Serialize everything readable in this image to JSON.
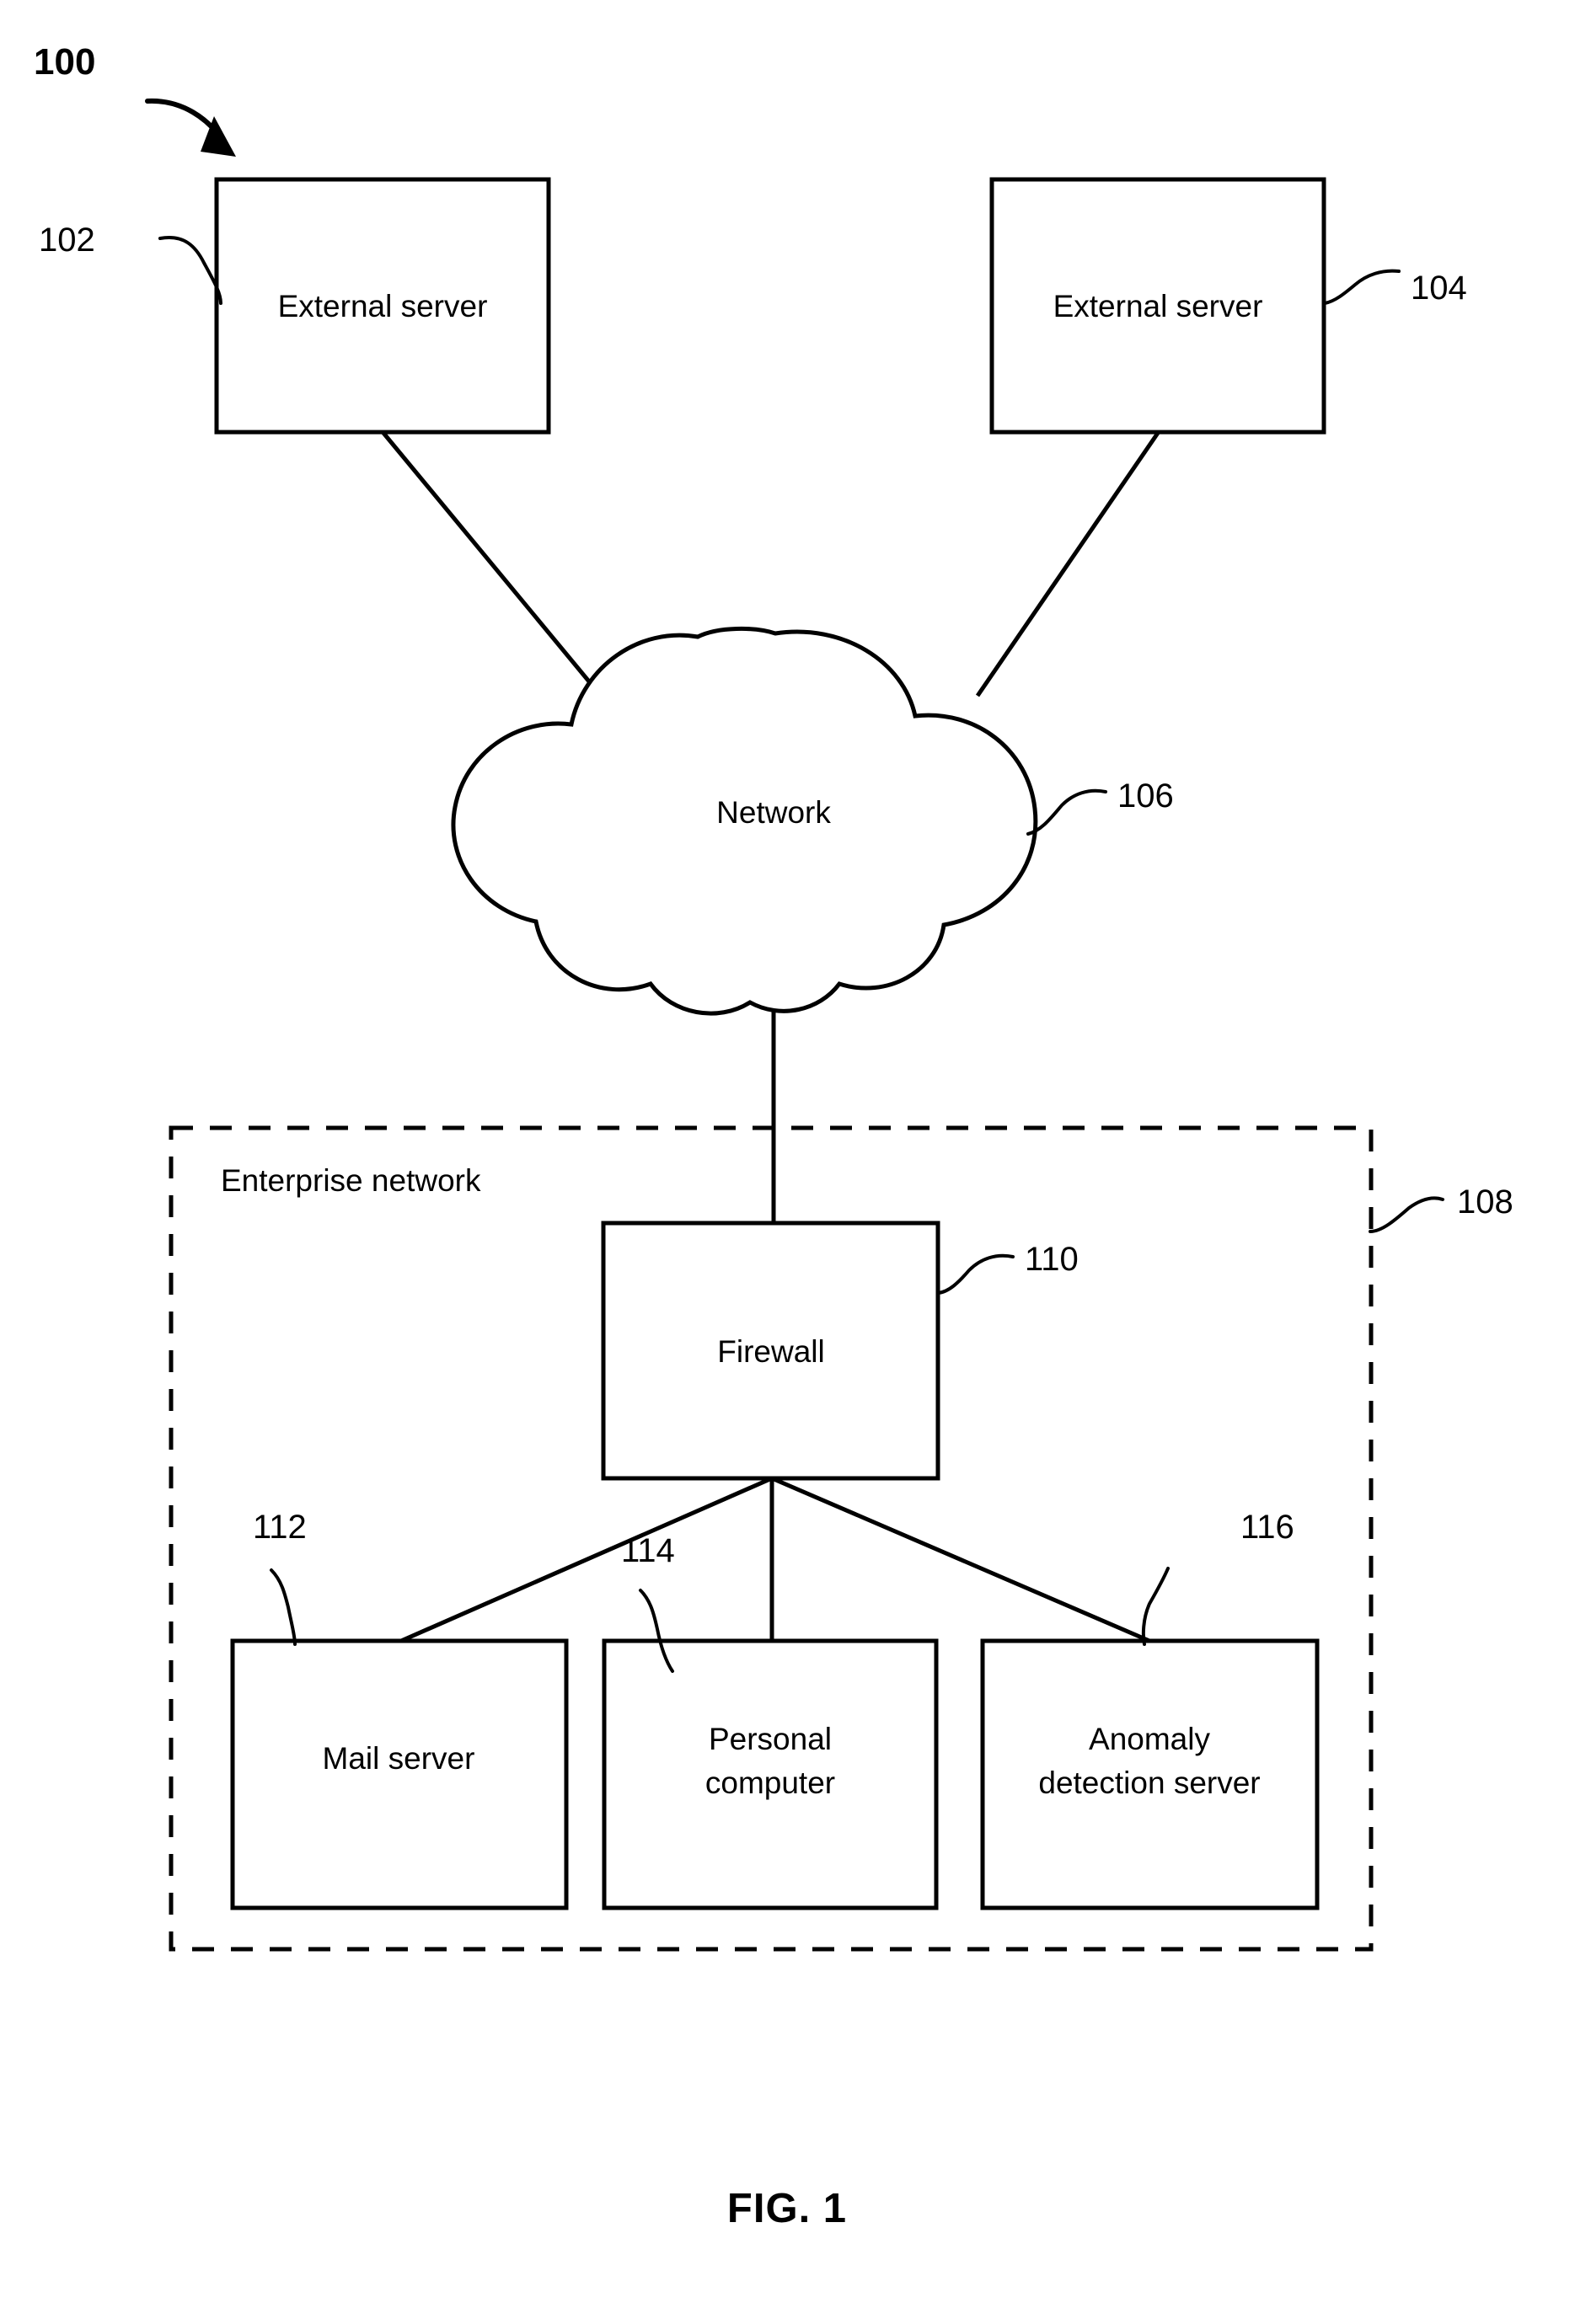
{
  "figure": {
    "caption": "FIG. 1",
    "system_ref": "100",
    "type": "network-architecture-diagram"
  },
  "nodes": [
    {
      "id": "external-server-left",
      "label": "External server",
      "ref": "102"
    },
    {
      "id": "external-server-right",
      "label": "External server",
      "ref": "104"
    },
    {
      "id": "network-cloud",
      "label": "Network",
      "ref": "106"
    },
    {
      "id": "firewall",
      "label": "Firewall",
      "ref": "110"
    },
    {
      "id": "mail-server",
      "label": "Mail server",
      "ref": "112"
    },
    {
      "id": "personal-computer",
      "label_line1": "Personal",
      "label_line2": "computer",
      "ref": "114"
    },
    {
      "id": "anomaly-detection-server",
      "label_line1": "Anomaly",
      "label_line2": "detection server",
      "ref": "116"
    }
  ],
  "zone": {
    "id": "enterprise-network",
    "label": "Enterprise network",
    "ref": "108"
  },
  "colors": {
    "stroke": "#000000",
    "background": "#ffffff",
    "text": "#000000"
  }
}
